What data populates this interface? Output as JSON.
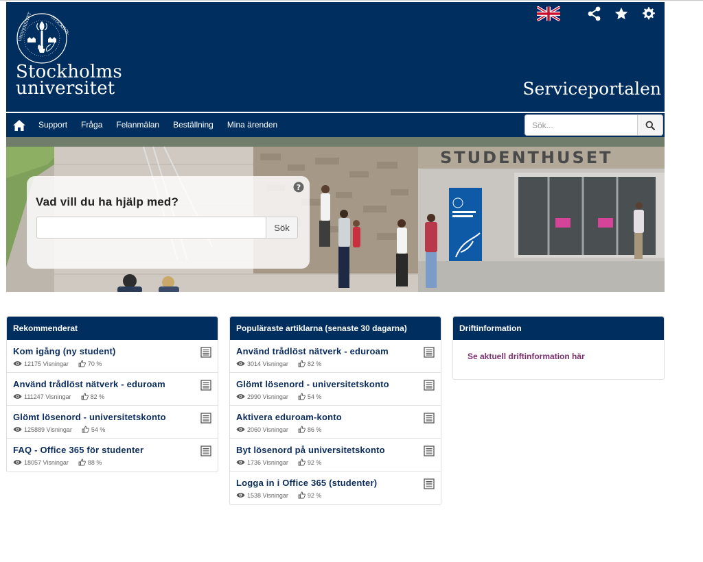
{
  "header": {
    "logo_line1": "Stockholms",
    "logo_line2": "universitet",
    "portal_title": "Serviceportalen",
    "icons": [
      "uk-flag-icon",
      "share-icon",
      "star-icon",
      "gear-icon"
    ]
  },
  "nav": {
    "items": [
      "Support",
      "Fråga",
      "Felanmälan",
      "Beställning",
      "Mina ärenden"
    ],
    "search_placeholder": "Sök..."
  },
  "hero": {
    "question": "Vad vill du ha hjälp med?",
    "search_button": "Sök",
    "sign_text": "STUDENTHUSET"
  },
  "panels": {
    "recommended": {
      "title": "Rekommenderat",
      "items": [
        {
          "title": "Kom igång (ny student)",
          "views": "12175 Visningar",
          "rating": "70 %"
        },
        {
          "title": "Använd trådlöst nätverk - eduroam",
          "views": "111247 Visningar",
          "rating": "82 %"
        },
        {
          "title": "Glömt lösenord - universitetskonto",
          "views": "125889 Visningar",
          "rating": "54 %"
        },
        {
          "title": "FAQ - Office 365 för studenter",
          "views": "18057 Visningar",
          "rating": "88 %"
        }
      ]
    },
    "popular": {
      "title": "Populäraste artiklarna (senaste 30 dagarna)",
      "items": [
        {
          "title": "Använd trådlöst nätverk - eduroam",
          "views": "3014 Visningar",
          "rating": "82 %"
        },
        {
          "title": "Glömt lösenord - universitetskonto",
          "views": "2990 Visningar",
          "rating": "54 %"
        },
        {
          "title": "Aktivera eduroam-konto",
          "views": "2060 Visningar",
          "rating": "86 %"
        },
        {
          "title": "Byt lösenord på universitetskonto",
          "views": "1736 Visningar",
          "rating": "92 %"
        },
        {
          "title": "Logga in i Office 365 (studenter)",
          "views": "1538 Visningar",
          "rating": "92 %"
        }
      ]
    },
    "drift": {
      "title": "Driftinformation",
      "link": "Se aktuell driftinformation här"
    }
  },
  "colors": {
    "brand_navy": "#002f5f",
    "link_purple": "#7b2f6e",
    "item_title": "#0a2b5c"
  }
}
